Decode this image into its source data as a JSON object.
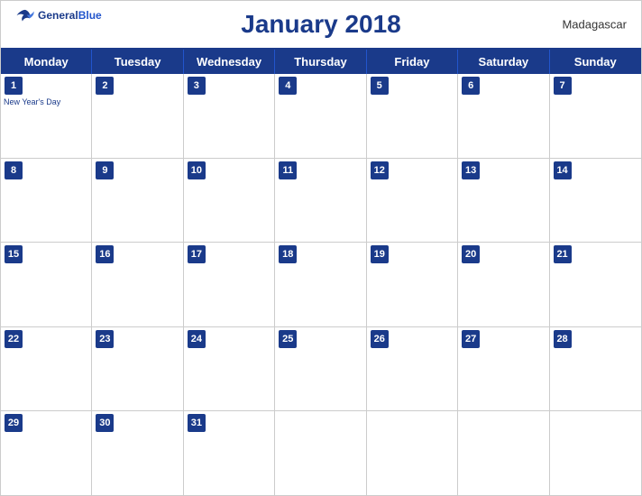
{
  "header": {
    "title": "January 2018",
    "country": "Madagascar",
    "logo": {
      "general": "General",
      "blue": "Blue"
    }
  },
  "days": {
    "headers": [
      "Monday",
      "Tuesday",
      "Wednesday",
      "Thursday",
      "Friday",
      "Saturday",
      "Sunday"
    ]
  },
  "weeks": [
    [
      {
        "num": "1",
        "holiday": "New Year's Day"
      },
      {
        "num": "2"
      },
      {
        "num": "3"
      },
      {
        "num": "4"
      },
      {
        "num": "5"
      },
      {
        "num": "6"
      },
      {
        "num": "7"
      }
    ],
    [
      {
        "num": "8"
      },
      {
        "num": "9"
      },
      {
        "num": "10"
      },
      {
        "num": "11"
      },
      {
        "num": "12"
      },
      {
        "num": "13"
      },
      {
        "num": "14"
      }
    ],
    [
      {
        "num": "15"
      },
      {
        "num": "16"
      },
      {
        "num": "17"
      },
      {
        "num": "18"
      },
      {
        "num": "19"
      },
      {
        "num": "20"
      },
      {
        "num": "21"
      }
    ],
    [
      {
        "num": "22"
      },
      {
        "num": "23"
      },
      {
        "num": "24"
      },
      {
        "num": "25"
      },
      {
        "num": "26"
      },
      {
        "num": "27"
      },
      {
        "num": "28"
      }
    ],
    [
      {
        "num": "29"
      },
      {
        "num": "30"
      },
      {
        "num": "31"
      },
      {
        "num": ""
      },
      {
        "num": ""
      },
      {
        "num": ""
      },
      {
        "num": ""
      }
    ]
  ]
}
